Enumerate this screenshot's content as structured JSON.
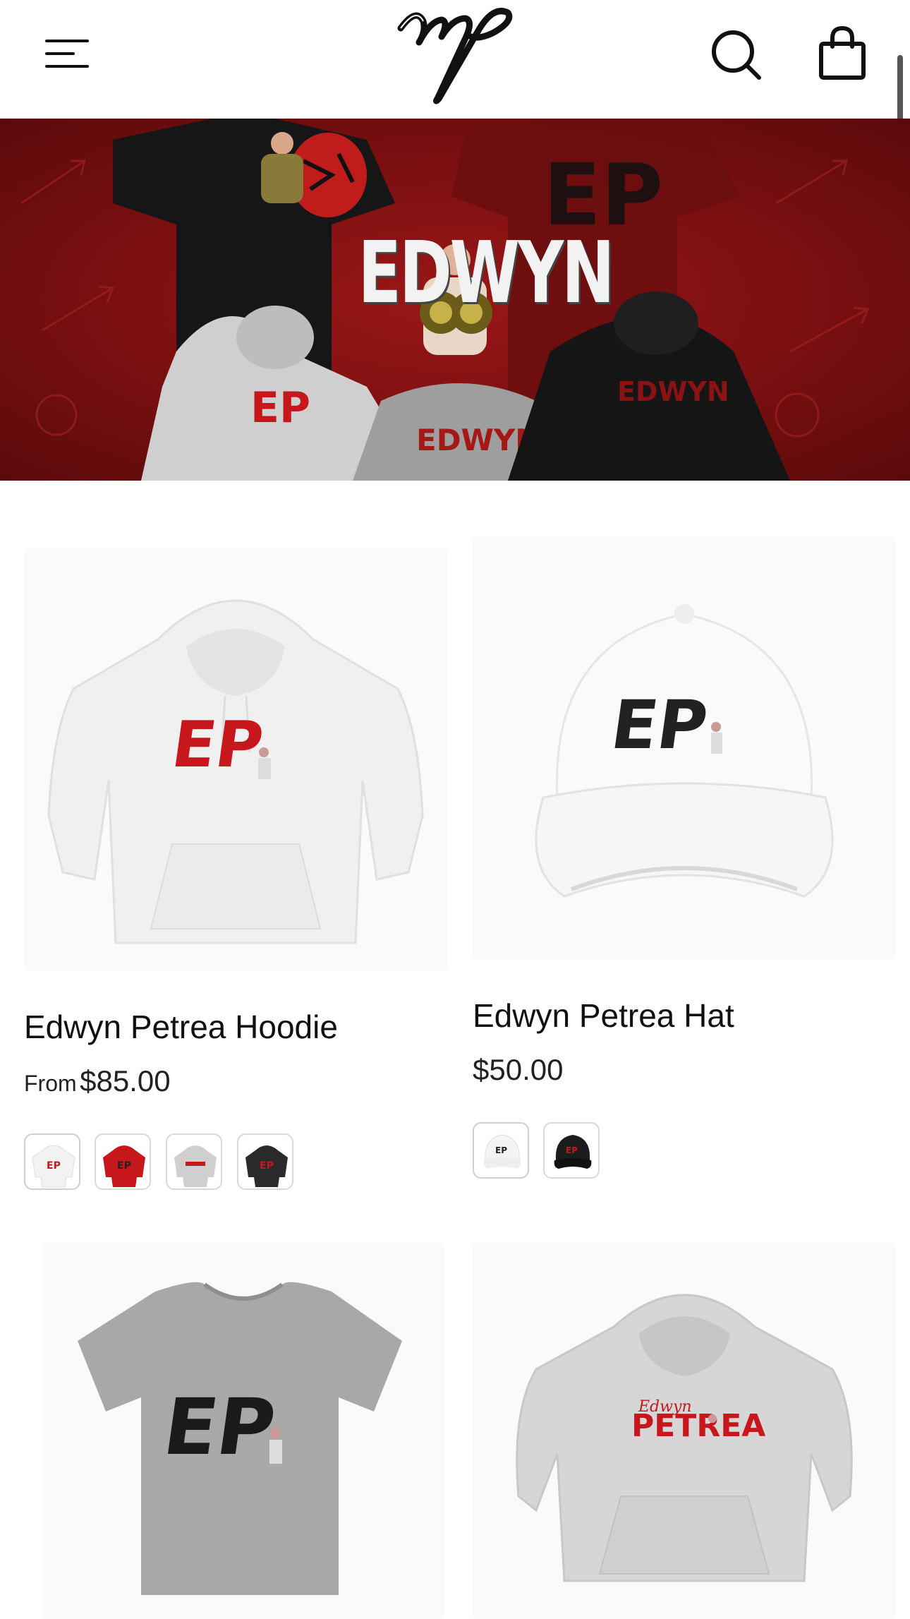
{
  "header": {
    "logo_text": "mp",
    "menu_icon": "menu-icon",
    "search_icon": "search-icon",
    "bag_icon": "shopping-bag-icon"
  },
  "hero": {
    "title": "EDWYN"
  },
  "products": [
    {
      "title": "Edwyn Petrea Hoodie",
      "price_prefix": "From",
      "price": "$85.00",
      "swatches": [
        "white",
        "red",
        "grey",
        "black"
      ]
    },
    {
      "title": "Edwyn Petrea Hat",
      "price_prefix": "",
      "price": "$50.00",
      "swatches": [
        "white",
        "black"
      ]
    },
    {
      "title": "",
      "price": ""
    },
    {
      "title": "",
      "price": ""
    }
  ],
  "colors": {
    "accent_red": "#c8161d",
    "hero_red": "#8a1214",
    "text": "#111111"
  }
}
